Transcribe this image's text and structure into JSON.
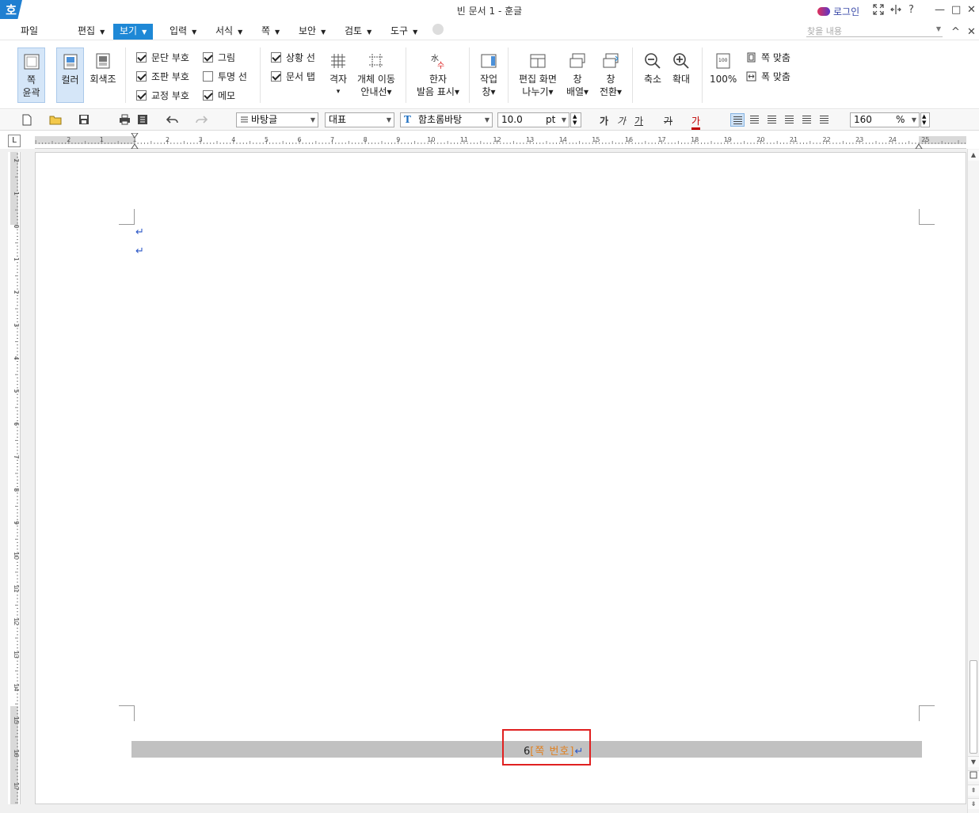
{
  "titlebar": {
    "app_icon": "호",
    "title": "빈 문서 1 - 훈글",
    "login_label": "로그인",
    "icons": [
      "fullscreen-icon",
      "split-icon",
      "help-icon",
      "minimize-icon",
      "restore-icon",
      "close-icon"
    ],
    "help_glyph": "?",
    "minimize_glyph": "—",
    "restore_glyph": "□",
    "close_glyph": "✕"
  },
  "menubar": {
    "items": [
      {
        "label": "파일"
      },
      {
        "label": "편집"
      },
      {
        "label": "보기"
      },
      {
        "label": "입력"
      },
      {
        "label": "서식"
      },
      {
        "label": "쪽"
      },
      {
        "label": "보안"
      },
      {
        "label": "검토"
      },
      {
        "label": "도구"
      }
    ],
    "active": "보기",
    "search_placeholder": "찾을 내용",
    "collapse_glyph": "^",
    "close_glyph": "✕",
    "dropdown_glyph": "▼"
  },
  "ribbon": {
    "page_outline": {
      "line1": "쪽",
      "line2": "윤곽"
    },
    "color": "컬러",
    "grayscale": "회색조",
    "checks": [
      {
        "label": "문단 부호",
        "checked": true
      },
      {
        "label": "조판 부호",
        "checked": true
      },
      {
        "label": "교정 부호",
        "checked": true
      },
      {
        "label": "그림",
        "checked": true
      },
      {
        "label": "투명 선",
        "checked": false
      },
      {
        "label": "메모",
        "checked": true
      },
      {
        "label": "상황 선",
        "checked": true
      },
      {
        "label": "문서 탭",
        "checked": true
      }
    ],
    "grid": "격자",
    "object_move": {
      "line1": "개체 이동",
      "line2": "안내선"
    },
    "hanja": {
      "line1": "한자",
      "line2": "발음 표시"
    },
    "work_pane": {
      "line1": "작업",
      "line2": "창"
    },
    "split_view": {
      "line1": "편집 화면",
      "line2": "나누기"
    },
    "arrange": {
      "line1": "창",
      "line2": "배열"
    },
    "switch": {
      "line1": "창",
      "line2": "전환"
    },
    "zoom_out": "축소",
    "zoom_in": "확대",
    "zoom_100": "100%",
    "fit_page": "쪽 맞춤",
    "fit_width": "폭 맞춤",
    "caret": "▾",
    "grid_caret": "▾"
  },
  "fmtbar": {
    "style": "바탕글",
    "lang": "대표",
    "font": "함초롬바탕",
    "size": "10.0",
    "unit": "pt",
    "zoom": "160",
    "zoom_unit": "%",
    "bold_glyph": "가",
    "italic_glyph": "가",
    "underline_glyph": "가",
    "strike_glyph": "가",
    "color_glyph": "가",
    "dropdown_glyph": "▼"
  },
  "ruler": {
    "corner": "L",
    "h_labels": [
      "2",
      "1",
      "1",
      "2",
      "3",
      "4",
      "5",
      "6",
      "7",
      "8",
      "9",
      "10",
      "11",
      "12",
      "13",
      "14",
      "15",
      "16",
      "17",
      "18",
      "19",
      "20",
      "21",
      "22",
      "23",
      "24",
      "25"
    ],
    "v_labels": [
      "2",
      "1",
      "0",
      "1",
      "2",
      "3",
      "4",
      "5",
      "6",
      "7",
      "8",
      "9",
      "10",
      "11",
      "12",
      "13",
      "14",
      "15",
      "16",
      "17"
    ]
  },
  "document": {
    "para_mark": "↵",
    "page_number_value": "6",
    "page_number_code": "[쪽 번호]"
  },
  "scrollbar": {
    "up": "▲",
    "down": "▼",
    "prev_page": "⇞",
    "next_page": "⇟"
  }
}
